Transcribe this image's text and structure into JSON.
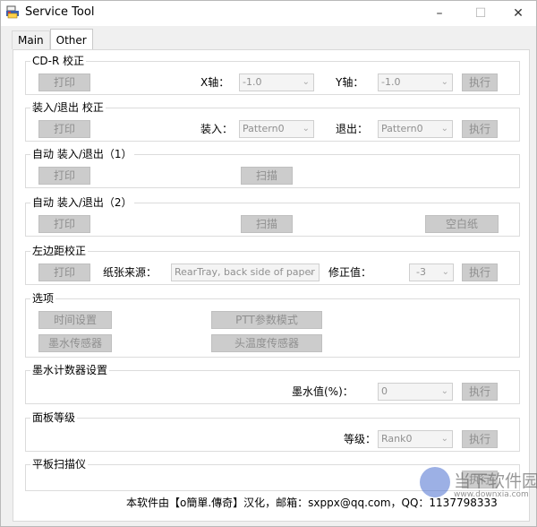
{
  "window": {
    "title": "Service Tool"
  },
  "tabs": [
    {
      "label": "Main"
    },
    {
      "label": "Other"
    }
  ],
  "cdr": {
    "title": "CD-R 校正",
    "print": "打印",
    "x_label": "X轴：",
    "x_value": "-1.0",
    "y_label": "Y轴：",
    "y_value": "-1.0",
    "exec": "执行"
  },
  "loadeject": {
    "title": "装入/退出 校正",
    "print": "打印",
    "load_label": "装入：",
    "load_value": "Pattern0",
    "eject_label": "退出：",
    "eject_value": "Pattern0",
    "exec": "执行"
  },
  "auto1": {
    "title": "自动 装入/退出（1）",
    "print": "打印",
    "scan": "扫描"
  },
  "auto2": {
    "title": "自动 装入/退出（2）",
    "print": "打印",
    "scan": "扫描",
    "blank": "空白纸"
  },
  "leftmargin": {
    "title": "左边距校正",
    "print": "打印",
    "source_label": "纸张来源：",
    "source_value": "RearTray, back side of paper",
    "corr_label": "修正值：",
    "corr_value": "-3",
    "exec": "执行"
  },
  "options": {
    "title": "选项",
    "time": "时间设置",
    "ptt": "PTT参数模式",
    "ink_sensor": "墨水传感器",
    "head_temp": "头温度传感器"
  },
  "inkcounter": {
    "title": "墨水计数器设置",
    "ink_label": "墨水值(%)：",
    "ink_value": "0",
    "exec": "执行"
  },
  "panel": {
    "title": "面板等级",
    "level_label": "等级：",
    "level_value": "Rank0",
    "exec": "执行"
  },
  "scanner": {
    "title": "平板扫描仪",
    "exec": "执行"
  },
  "footer": {
    "text": "本软件由【o簡單.傳奇】汉化，邮箱：sxppx@qq.com，QQ：1137798333"
  },
  "watermark": {
    "text": "当下软件园",
    "sub": "www.downxia.com"
  }
}
